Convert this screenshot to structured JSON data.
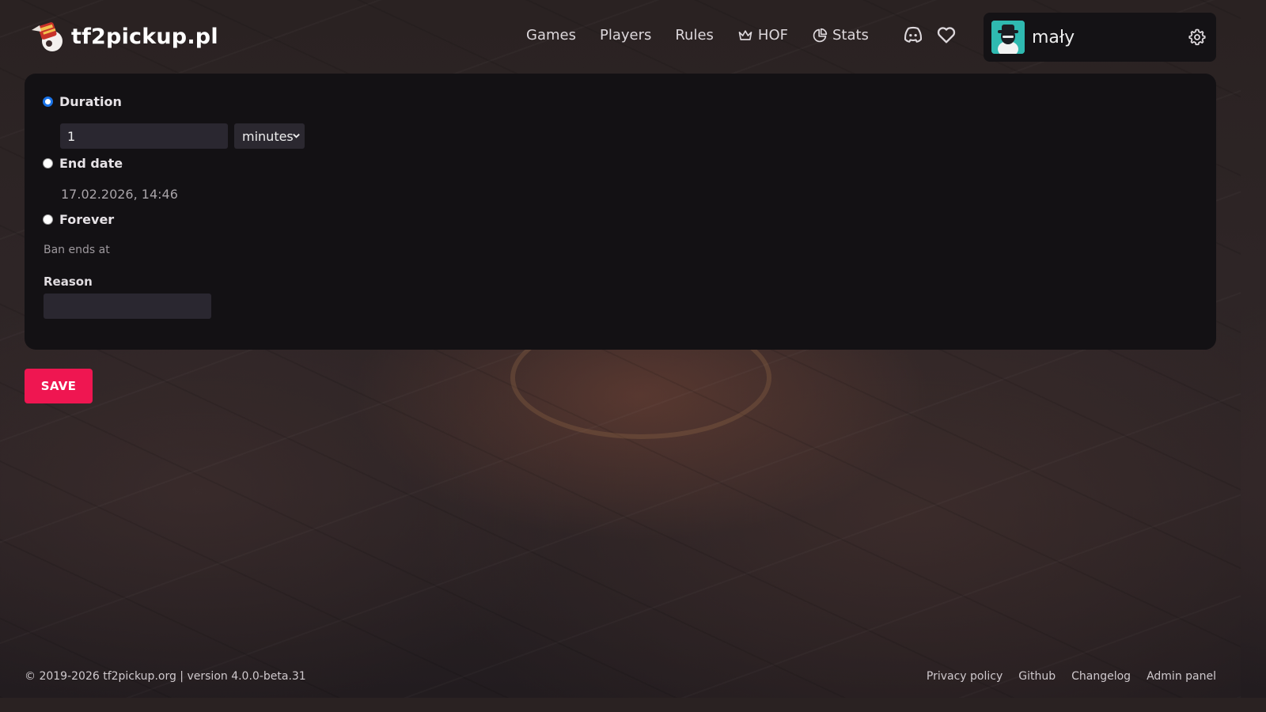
{
  "brand": {
    "logo_text": "tf2pickup.pl",
    "logo_icon": "tf2pickup-logo"
  },
  "nav": {
    "items": [
      {
        "label": "Games",
        "icon": ""
      },
      {
        "label": "Players",
        "icon": ""
      },
      {
        "label": "Rules",
        "icon": ""
      },
      {
        "label": "HOF",
        "icon": "crown-icon"
      },
      {
        "label": "Stats",
        "icon": "pie-chart-icon"
      }
    ],
    "right_icons": [
      "discord-icon",
      "heart-icon"
    ]
  },
  "user": {
    "name": "mały",
    "avatar_icon": "avatar",
    "settings_icon": "gear-icon"
  },
  "form": {
    "duration": {
      "label": "Duration",
      "checked": true,
      "value": "1",
      "unit": "minutes"
    },
    "end_date": {
      "label": "End date",
      "checked": false,
      "value": "17.02.2026, 14:46"
    },
    "forever": {
      "label": "Forever",
      "checked": false
    },
    "ban_ends_at": "Ban ends at",
    "reason": {
      "label": "Reason",
      "value": ""
    },
    "save_label": "SAVE"
  },
  "footer": {
    "copyright": "© 2019-2026 tf2pickup.org | version 4.0.0-beta.31",
    "links": [
      "Privacy policy",
      "Github",
      "Changelog",
      "Admin panel"
    ]
  },
  "colors": {
    "accent": "#ef1651",
    "panel_bg": "#131114",
    "radio_checked": "#1a73e8"
  }
}
